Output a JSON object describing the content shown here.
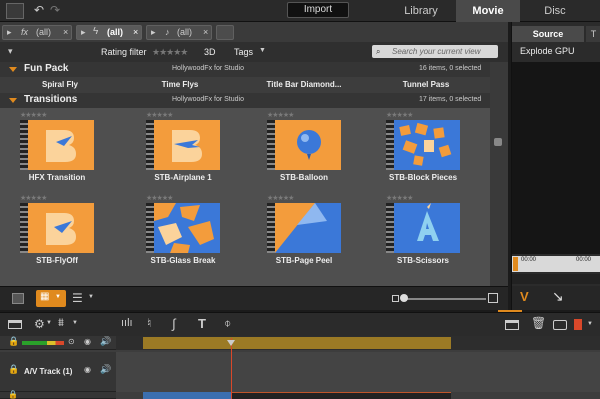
{
  "topbar": {
    "import_label": "Import",
    "tabs": [
      {
        "label": "Library",
        "active": false
      },
      {
        "label": "Movie",
        "active": true
      },
      {
        "label": "Disc",
        "active": false
      }
    ]
  },
  "filter_tabs": [
    {
      "prefix": "fx",
      "label": "(all)"
    },
    {
      "prefix": "",
      "label": "(all)"
    },
    {
      "prefix": "",
      "label": "(all)"
    }
  ],
  "filter_bar": {
    "rating_filter_label": "Rating filter",
    "rating_stars": "★★★★★",
    "three_d_label": "3D",
    "tags_label": "Tags",
    "search_placeholder": "Search your current view"
  },
  "groups": [
    {
      "name": "Fun Pack",
      "source": "HollywoodFx for Studio",
      "count": "16 items, 0 selected",
      "items": [
        "Spiral Fly",
        "Time Flys",
        "Title Bar Diamond...",
        "Tunnel Pass"
      ]
    },
    {
      "name": "Transitions",
      "source": "HollywoodFx for Studio",
      "count": "17 items, 0 selected",
      "items": [
        "HFX Transition",
        "STB-Airplane 1",
        "STB-Balloon",
        "STB-Block Pieces",
        "STB-FlyOff",
        "STB-Glass Break",
        "STB-Page Peel",
        "STB-Scissors"
      ]
    }
  ],
  "tile_stars": "★★★★★",
  "right_panel": {
    "tabs": [
      "Source",
      "T"
    ],
    "title": "Explode GPU",
    "timecode_start": "00:00",
    "timecode_mid": "00:00"
  },
  "tracks": {
    "av_track_label": "A/V Track (1)"
  },
  "colors": {
    "accent_orange": "#e08a1e",
    "thumb_orange": "#f39c3c",
    "thumb_blue": "#3b78d8",
    "active_tab": "#4a4a4a"
  }
}
